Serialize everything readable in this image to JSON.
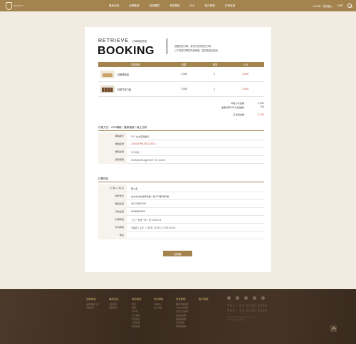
{
  "header": {
    "logo_text": "WALNUT",
    "nav": [
      "最新消息",
      "品牌故事",
      "商品購買",
      "會員專區",
      "FAQ",
      "客戶服務",
      "訂單查詢"
    ],
    "login_label": "LOGIN · 會員登入",
    "cart_label": "CART",
    "brand_color": "#a3844f"
  },
  "card": {
    "kicker_en": "RETRIEVE",
    "kicker_zh": "訂單明細查詢",
    "title": "BOOKING",
    "intro_line1": "感謝您的訂購，我們已收到您的訂單，",
    "intro_line2": "以下為您訂購的商品明細，並請保留此頁面。"
  },
  "products": {
    "headers": [
      "訂購商品",
      "售價",
      "數量",
      "小計"
    ],
    "rows": [
      {
        "name": "精緻禮盒組",
        "price": "2,500",
        "qty": "1",
        "subtotal": "2,500"
      },
      {
        "name": "精選巧克力組",
        "price": "2,500",
        "qty": "1",
        "subtotal": "2,500"
      }
    ],
    "totals": [
      {
        "label": "商品小計金額",
        "value": "5,000"
      },
      {
        "label": "運費(滿3000元免運費)",
        "value": "150"
      }
    ],
    "grand": {
      "label": "訂單總金額",
      "value": "5,150"
    }
  },
  "payment": {
    "title": "付款方式：ATM轉帳 / 匯款帳號 / 線上付款",
    "rows": [
      {
        "label": "轉帳銀行",
        "value": "012 台北富邦銀行",
        "red": false
      },
      {
        "label": "轉帳帳號",
        "value": "1470-8796-4512-0071",
        "red": true
      },
      {
        "label": "轉帳金額",
        "value": "5,150元",
        "red": false
      },
      {
        "label": "繳款期限",
        "value": "2015/01/31 前23:59 下午 24:00",
        "red": false
      }
    ]
  },
  "order": {
    "title": "訂購資訊",
    "rows": [
      {
        "label": "訂 購 人 姓 名",
        "value": "陳小美"
      },
      {
        "label": "收件地址",
        "value": "台中市北屯區崇德路一段147巷3號2樓"
      },
      {
        "label": "聯絡電話",
        "value": "04-24363749"
      },
      {
        "label": "行動電話",
        "value": "0936663569"
      },
      {
        "label": "訂購時間",
        "value": "二〇一五年一月一日 14:25:11"
      },
      {
        "label": "到貨時間",
        "value": "不指定 / 上午 / 13:00-17:00 / 17:00-20:00"
      },
      {
        "label": "備註",
        "value": ""
      }
    ]
  },
  "actions": {
    "back_label": "回首頁"
  },
  "footer": {
    "columns": [
      {
        "title": "品牌故事",
        "links": [
          "品牌故事介紹",
          "店鋪資訊"
        ]
      },
      {
        "title": "最新消息",
        "links": [
          "活動消息",
          "媒體報導"
        ]
      },
      {
        "title": "商品購買",
        "links": [
          "禮盒",
          "蛋糕",
          "伴手禮",
          "手工餅乾",
          "節慶商品",
          "冷藏商品",
          "限量商品"
        ]
      },
      {
        "title": "會員專區",
        "links": [
          "會員登入",
          "加入會員"
        ]
      },
      {
        "title": "常見問題",
        "links": [
          "購物流程說明",
          "付款方式說明",
          "運送方式說明",
          "退換貨說明",
          "客服與服務",
          "訂單查詢",
          "隱私權政策"
        ]
      },
      {
        "title": "客戶服務",
        "links": []
      }
    ],
    "social_icons": [
      "facebook-icon",
      "twitter-icon",
      "google-plus-icon",
      "instagram-icon",
      "mail-icon"
    ],
    "tel": "TEL：04-2245-6300",
    "fax": "FAX：04-2245-6800",
    "email": "service@walnutbakery.com.tw",
    "copyright": "© WALNUT BAKERY"
  }
}
